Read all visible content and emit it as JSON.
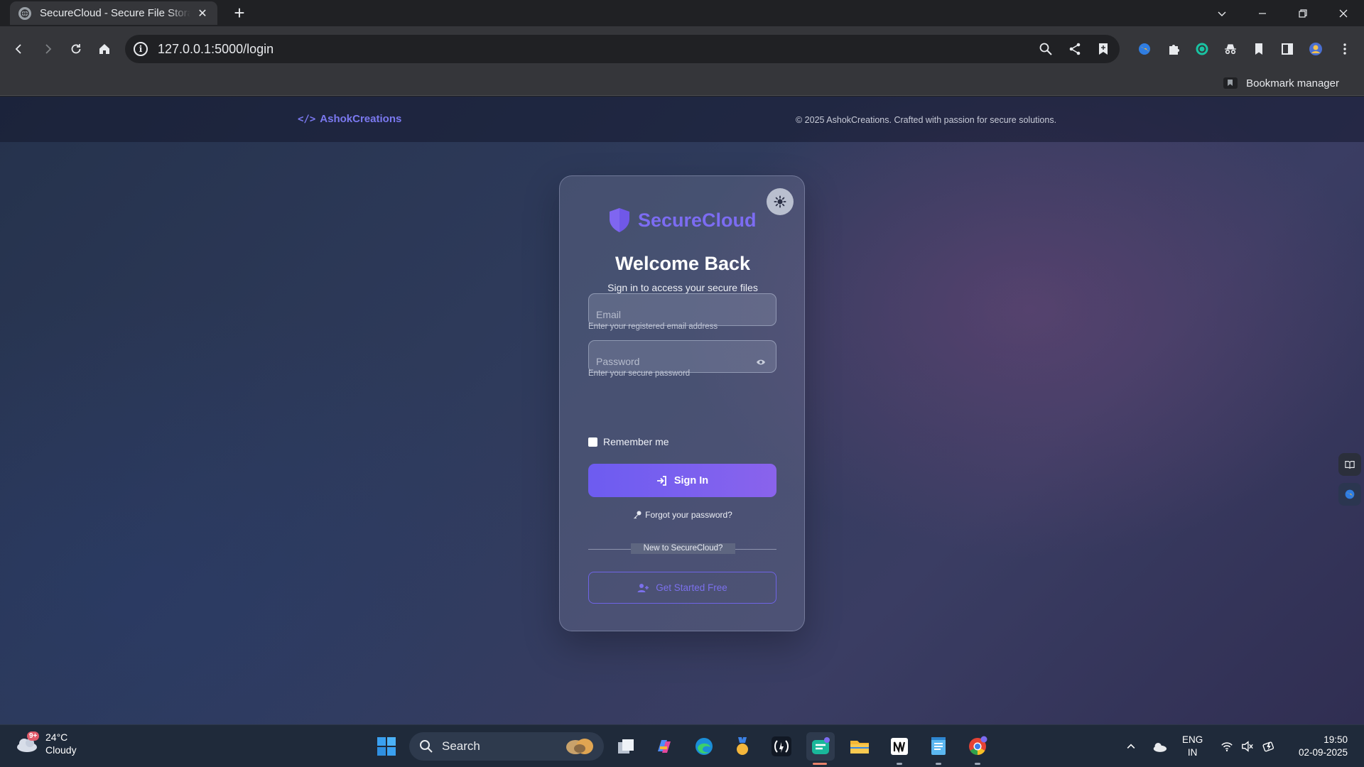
{
  "browser": {
    "tab_title": "SecureCloud - Secure File Storage",
    "url": "127.0.0.1:5000/login",
    "bookmark_manager_label": "Bookmark manager"
  },
  "site": {
    "brand": "AshokCreations",
    "brand_icon": "</>",
    "copyright": "© 2025 AshokCreations. Crafted with passion for secure solutions."
  },
  "login": {
    "logo_text": "SecureCloud",
    "title": "Welcome Back",
    "subtitle": "Sign in to access your secure files",
    "email_placeholder": "Email",
    "email_hint": "Enter your registered email address",
    "password_placeholder": "Password",
    "password_hint": "Enter your secure password",
    "remember_label": "Remember me",
    "remember_checked": false,
    "signin_label": "Sign In",
    "forgot_label": "Forgot your password?",
    "divider_text": "New to SecureCloud?",
    "get_started_label": "Get Started Free"
  },
  "taskbar": {
    "weather_badge": "9+",
    "temperature": "24°C",
    "condition": "Cloudy",
    "search_label": "Search",
    "lang_line1": "ENG",
    "lang_line2": "IN",
    "time": "19:50",
    "date": "02-09-2025"
  },
  "colors": {
    "accent": "#7c6cf2",
    "button_gradient_start": "#6d5cf0",
    "button_gradient_end": "#8a63ec",
    "brand": "#7b79f0"
  }
}
